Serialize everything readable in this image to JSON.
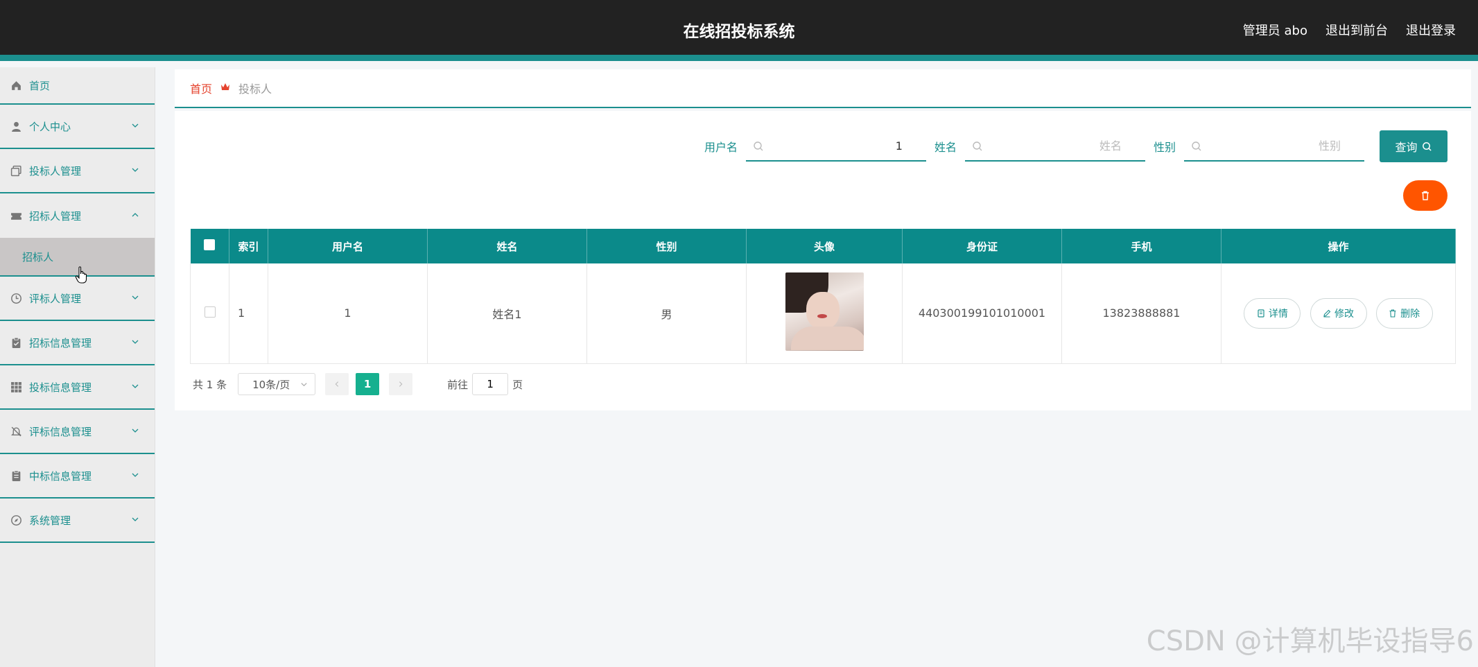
{
  "header": {
    "title": "在线招投标系统",
    "user": "管理员 abo",
    "front_link": "退出到前台",
    "logout": "退出登录"
  },
  "sidebar": {
    "items": [
      {
        "label": "首页",
        "icon": "home-icon"
      },
      {
        "label": "个人中心",
        "icon": "user-icon"
      },
      {
        "label": "投标人管理",
        "icon": "copy-icon"
      },
      {
        "label": "招标人管理",
        "icon": "ticket-icon",
        "expanded": true,
        "children": [
          {
            "label": "招标人"
          }
        ]
      },
      {
        "label": "评标人管理",
        "icon": "clock-icon"
      },
      {
        "label": "招标信息管理",
        "icon": "clipboard-icon"
      },
      {
        "label": "投标信息管理",
        "icon": "grid-icon"
      },
      {
        "label": "评标信息管理",
        "icon": "bell-off-icon"
      },
      {
        "label": "中标信息管理",
        "icon": "document-icon"
      },
      {
        "label": "系统管理",
        "icon": "compass-icon"
      }
    ]
  },
  "breadcrumb": {
    "home": "首页",
    "current": "投标人"
  },
  "search": {
    "username_label": "用户名",
    "username_value": "1",
    "name_label": "姓名",
    "name_placeholder": "姓名",
    "gender_label": "性别",
    "gender_placeholder": "性别",
    "query_label": "查询"
  },
  "table": {
    "headers": [
      "索引",
      "用户名",
      "姓名",
      "性别",
      "头像",
      "身份证",
      "手机",
      "操作"
    ],
    "rows": [
      {
        "index": "1",
        "username": "1",
        "name": "姓名1",
        "gender": "男",
        "id_card": "440300199101010001",
        "phone": "13823888881"
      }
    ],
    "actions": {
      "detail": "详情",
      "edit": "修改",
      "delete": "删除"
    }
  },
  "pager": {
    "total": "共 1 条",
    "page_size": "10条/页",
    "current_page": "1",
    "goto_prefix": "前往",
    "goto_value": "1",
    "goto_suffix": "页"
  },
  "watermark": "CSDN @计算机毕设指导6",
  "colors": {
    "accent": "#1b8f8e",
    "header_bg": "#222222",
    "danger": "#ff5500",
    "page_active": "#16b08f"
  }
}
